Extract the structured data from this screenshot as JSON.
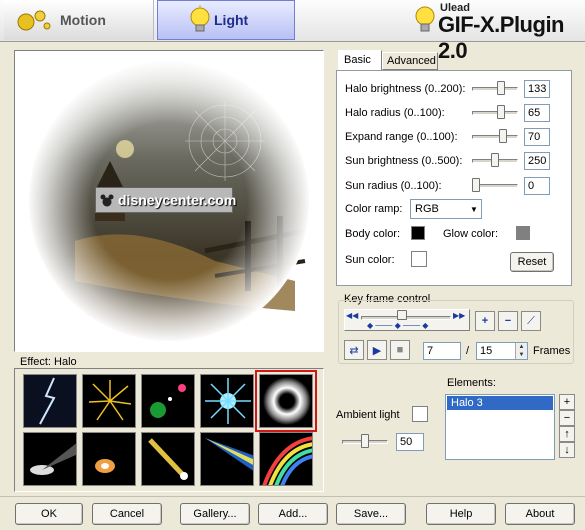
{
  "header": {
    "tabs": [
      {
        "label": "Motion",
        "active": false
      },
      {
        "label": "Light",
        "active": true
      }
    ],
    "brand_small": "Ulead",
    "brand": "GIF-X.Plugin 2.0"
  },
  "preview": {
    "watermark": "disneycenter.com"
  },
  "effect": {
    "label": "Effect: Halo",
    "thumbnails": [
      "lightning",
      "fireworks",
      "lens-flare",
      "star-burst",
      "halo",
      "spotlight",
      "glow",
      "comet",
      "light-beam",
      "rainbow"
    ],
    "selected_index": 4
  },
  "settings": {
    "tabs": [
      {
        "label": "Basic"
      },
      {
        "label": "Advanced"
      }
    ],
    "rows": [
      {
        "label": "Halo brightness (0..200):",
        "value": "133",
        "level": 0.665
      },
      {
        "label": "Halo radius (0..100):",
        "value": "65",
        "level": 0.65
      },
      {
        "label": "Expand range (0..100):",
        "value": "70",
        "level": 0.7
      },
      {
        "label": "Sun brightness (0..500):",
        "value": "250",
        "level": 0.5
      },
      {
        "label": "Sun radius (0..100):",
        "value": "0",
        "level": 0.0
      }
    ],
    "color_ramp_label": "Color ramp:",
    "color_ramp_value": "RGB",
    "body_color_label": "Body color:",
    "glow_color_label": "Glow color:",
    "sun_color_label": "Sun color:",
    "reset_label": "Reset",
    "colors": {
      "body": "#000000",
      "glow": "#808080",
      "sun": "#ffffff"
    }
  },
  "keyframe": {
    "label": "Key frame control",
    "current": "7",
    "separator": "/",
    "total": "15",
    "unit": "Frames"
  },
  "elements": {
    "label": "Elements:",
    "items": [
      "Halo 3"
    ],
    "side_buttons": [
      "+",
      "−",
      "↑",
      "↓"
    ]
  },
  "ambient": {
    "label": "Ambient light",
    "value": "50",
    "level": 0.5
  },
  "footer": {
    "buttons": [
      "OK",
      "Cancel",
      "Gallery...",
      "Add...",
      "Save...",
      "Help",
      "About"
    ]
  }
}
